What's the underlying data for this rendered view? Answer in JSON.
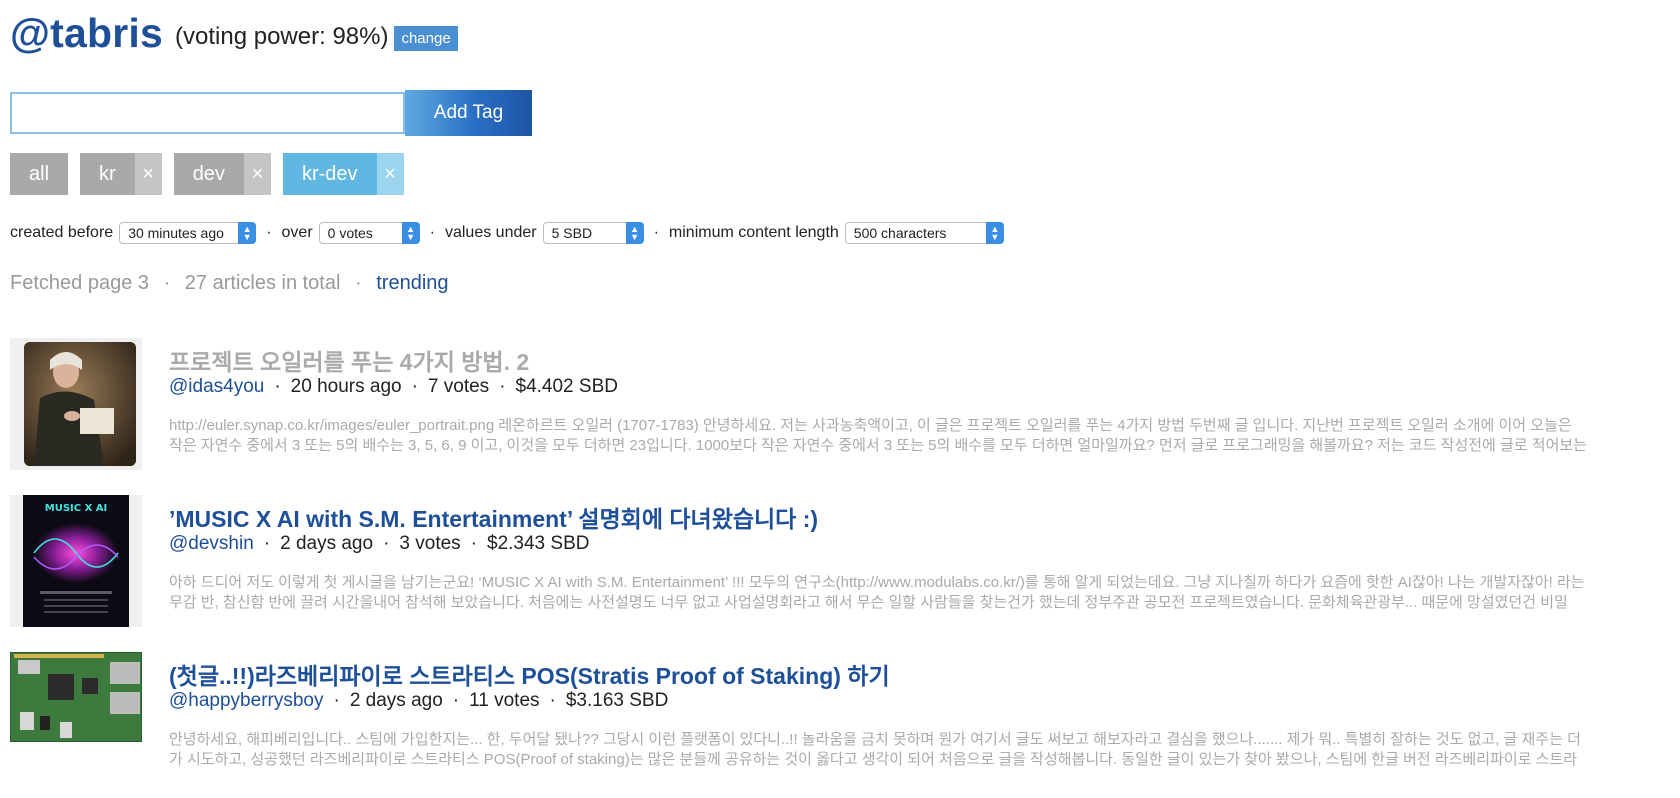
{
  "header": {
    "user": "@tabris",
    "voting_power": "(voting power: 98%)",
    "change_label": "change"
  },
  "tag_input": {
    "value": "",
    "placeholder": "",
    "add_label": "Add Tag"
  },
  "tags": [
    {
      "label": "all",
      "removable": false,
      "active": false
    },
    {
      "label": "kr",
      "removable": true,
      "active": false
    },
    {
      "label": "dev",
      "removable": true,
      "active": false
    },
    {
      "label": "kr-dev",
      "removable": true,
      "active": true
    }
  ],
  "filters": {
    "created_before_label": "created before",
    "created_before_value": "30 minutes ago",
    "over_label": "over",
    "over_value": "0 votes",
    "values_under_label": "values under",
    "values_under_value": "5 SBD",
    "min_length_label": "minimum content length",
    "min_length_value": "500 characters",
    "separator": "·"
  },
  "summary": {
    "fetched": "Fetched page 3",
    "total": "27 articles in total",
    "link": "trending",
    "separator": "·"
  },
  "articles": [
    {
      "title": "프로젝트 오일러를 푸는 4가지 방법. 2",
      "author": "@idas4you",
      "age": "20 hours ago",
      "votes": "7 votes",
      "value": "$4.402 SBD",
      "excerpt_line1": "http://euler.synap.co.kr/images/euler_portrait.png 레온하르트 오일러 (1707-1783) 안녕하세요. 저는 사과농축액이고, 이 글은 프로젝트 오일러를 푸는 4가지 방법 두번째 글 입니다. 지난번 프로젝트 오일러 소개에 이어 오늘은",
      "excerpt_line2": "작은 자연수 중에서 3 또는 5의 배수는 3, 5, 6, 9 이고, 이것을 모두 더하면 23입니다. 1000보다 작은 자연수 중에서 3 또는 5의 배수를 모두 더하면 얼마일까요? 먼저 글로 프로그래밍을 해볼까요? 저는 코드 작성전에 글로 적어보는",
      "state": "seen",
      "thumb": "portrait"
    },
    {
      "title": "’MUSIC X AI with S.M. Entertainment’ 설명회에 다녀왔습니다 :)",
      "author": "@devshin",
      "age": "2 days ago",
      "votes": "3 votes",
      "value": "$2.343 SBD",
      "excerpt_line1": "아하 드디어 저도 이렇게 첫 게시글을 남기는군요! ‘MUSIC X AI with S.M. Entertainment’ !!! 모두의 연구소(http://www.modulabs.co.kr/)를 통해 알게 되었는데요. 그냥 지나칠까 하다가 요즘에 핫한 AI잖아! 나는 개발자잖아! 라는",
      "excerpt_line2": "무감 반, 참신함 반에 끌려 시간을내어 참석해 보았습니다. 처음에는 사전설명도 너무 없고 사업설명회라고 해서 무슨 일할 사람들을 찾는건가 했는데 정부주관 공모전 프로젝트였습니다. 문화체육관광부... 때문에 망설였던건 비밀",
      "state": "fresh",
      "thumb": "poster",
      "thumb_text": "MUSIC X AI"
    },
    {
      "title": "(첫글..!!)라즈베리파이로 스트라티스 POS(Stratis Proof of Staking) 하기",
      "author": "@happyberrysboy",
      "age": "2 days ago",
      "votes": "11 votes",
      "value": "$3.163 SBD",
      "excerpt_line1": "안녕하세요, 해피베리입니다.. 스팀에 가입한지는... 한, 두어달 됐나?? 그당시 이런 플랫폼이 있다니..!! 놀라움을 금치 못하며 뭔가 여기서 글도 써보고 해보자라고 결심을 했으나....... 제가 뭐.. 특별히 잘하는 것도 없고, 글 재주는 더",
      "excerpt_line2": "가 시도하고, 성공했던 라즈베리파이로 스트라티스 POS(Proof of staking)는 많은 분들께 공유하는 것이 옳다고 생각이 되어 처음으로 글을 작성해봅니다. 동일한 글이 있는가 찾아 봤으나, 스팀에 한글 버전 라즈베리파이로 스트라",
      "state": "fresh",
      "thumb": "board"
    }
  ]
}
